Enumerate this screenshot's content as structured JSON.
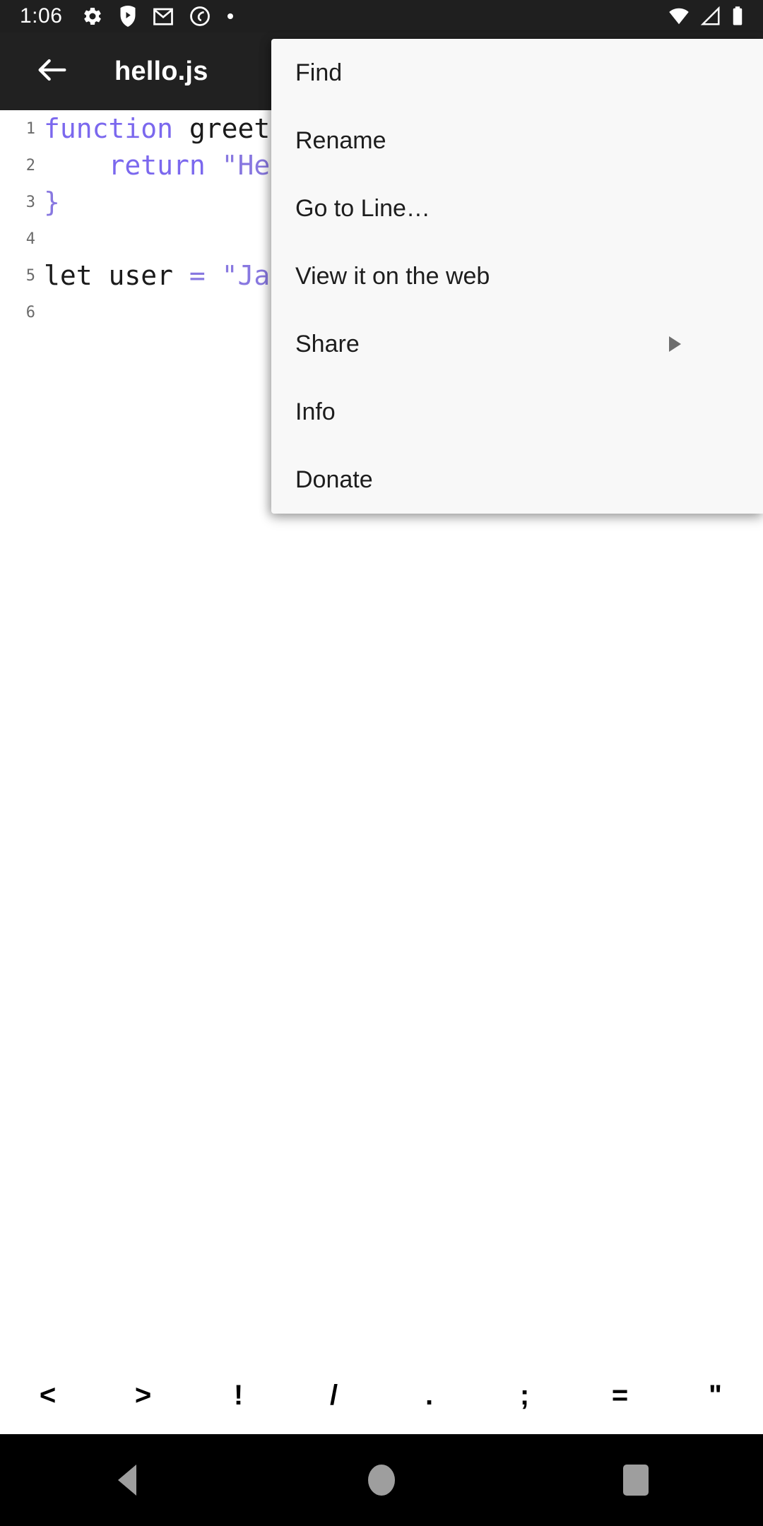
{
  "status_bar": {
    "time": "1:06",
    "left_icons": [
      "gear-icon",
      "play-shield-icon",
      "gmail-icon",
      "circle-slash-icon",
      "dot-icon"
    ],
    "right_icons": [
      "wifi-icon",
      "cell-signal-icon",
      "battery-icon"
    ],
    "background": "#1f1f1f",
    "foreground": "#ffffff"
  },
  "app_bar": {
    "back_icon": "arrow-left-icon",
    "title": "hello.js",
    "background": "#212121",
    "foreground": "#ffffff"
  },
  "editor": {
    "background": "#ffffff",
    "keyword_color": "#7b68ee",
    "string_color": "#8878e0",
    "text_color": "#1b1b1b",
    "gutter_color": "#6b6b6b",
    "lines": [
      {
        "number": "1",
        "segments": [
          {
            "text": "function ",
            "type": "kw"
          },
          {
            "text": "greeter",
            "type": "plain"
          },
          {
            "text": "(",
            "type": "pun"
          }
        ]
      },
      {
        "number": "2",
        "segments": [
          {
            "text": "    return ",
            "type": "kw"
          },
          {
            "text": "\"Hello",
            "type": "str"
          }
        ]
      },
      {
        "number": "3",
        "segments": [
          {
            "text": "}",
            "type": "pun"
          }
        ]
      },
      {
        "number": "4",
        "segments": []
      },
      {
        "number": "5",
        "segments": [
          {
            "text": "let user ",
            "type": "plain"
          },
          {
            "text": "= ",
            "type": "pun"
          },
          {
            "text": "\"Jane",
            "type": "str"
          }
        ]
      },
      {
        "number": "6",
        "segments": []
      }
    ]
  },
  "popup_menu": {
    "background": "#f8f8f8",
    "text_color": "#1d1d1d",
    "items": [
      {
        "label": "Find",
        "has_submenu": false
      },
      {
        "label": "Rename",
        "has_submenu": false
      },
      {
        "label": "Go to Line…",
        "has_submenu": false
      },
      {
        "label": "View it on the web",
        "has_submenu": false
      },
      {
        "label": "Share",
        "has_submenu": true
      },
      {
        "label": "Info",
        "has_submenu": false
      },
      {
        "label": "Donate",
        "has_submenu": false
      }
    ]
  },
  "symbol_bar": {
    "background": "#ffffff",
    "symbols": [
      "<",
      ">",
      "!",
      "/",
      ".",
      ";",
      "=",
      "\""
    ]
  },
  "navigation_bar": {
    "background": "#000000",
    "icon_color": "#9e9e9e",
    "buttons": [
      "back-nav-icon",
      "home-nav-icon",
      "recents-nav-icon"
    ]
  }
}
